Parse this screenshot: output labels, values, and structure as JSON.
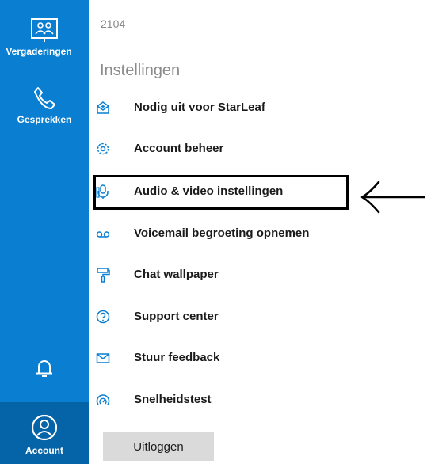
{
  "sidebar": {
    "meetings_label": "Vergaderingen",
    "calls_label": "Gesprekken",
    "account_label": "Account"
  },
  "main": {
    "user_id": "2104",
    "section_title": "Instellingen",
    "items": [
      {
        "label": "Nodig uit voor StarLeaf",
        "icon": "invite-icon"
      },
      {
        "label": "Account beheer",
        "icon": "gear-icon"
      },
      {
        "label": "Audio & video instellingen",
        "icon": "audio-video-icon"
      },
      {
        "label": "Voicemail begroeting opnemen",
        "icon": "voicemail-icon"
      },
      {
        "label": "Chat wallpaper",
        "icon": "paint-roller-icon"
      },
      {
        "label": "Support center",
        "icon": "help-icon"
      },
      {
        "label": "Stuur feedback",
        "icon": "mail-icon"
      },
      {
        "label": "Snelheidstest",
        "icon": "speedometer-icon"
      }
    ],
    "logout_label": "Uitloggen"
  },
  "colors": {
    "sidebar": "#0a7fd1",
    "sidebar_active": "#0563a7",
    "icon": "#0a7fd1"
  }
}
